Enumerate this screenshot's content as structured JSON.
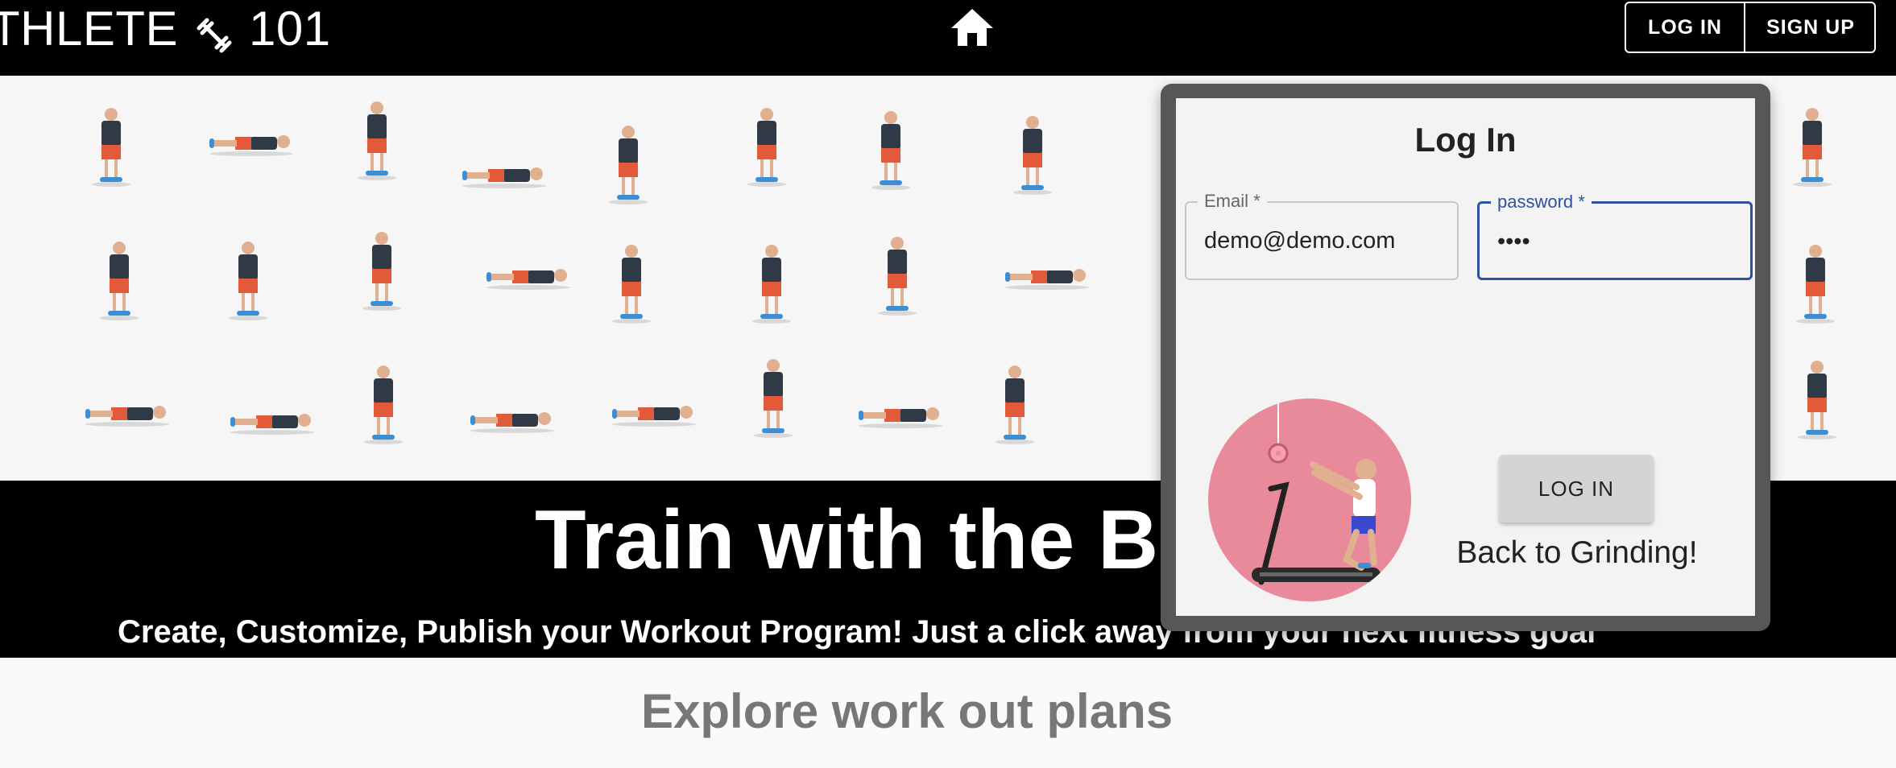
{
  "navbar": {
    "brand_text": "THLETE",
    "brand_suffix": "101",
    "icons": {
      "brand": "dumbbell-icon",
      "home": "home-icon"
    },
    "login_label": "LOG IN",
    "signup_label": "SIGN UP"
  },
  "hero": {
    "title": "Train with the B",
    "subtitle": "Create, Customize, Publish your Workout Program! Just a click away from your next fitness goal"
  },
  "explore": {
    "title": "Explore work out plans"
  },
  "login_modal": {
    "title": "Log In",
    "email_label": "Email *",
    "email_value": "demo@demo.com",
    "password_label": "password *",
    "password_value": "demo",
    "submit_label": "LOG IN",
    "tagline": "Back to Grinding!",
    "illustration": "treadmill-donut-illustration"
  },
  "colors": {
    "navbar_bg": "#000000",
    "accent_blue": "#3050a0",
    "illustration_pink": "#e88a9a",
    "shorts_orange": "#e25a3a"
  }
}
